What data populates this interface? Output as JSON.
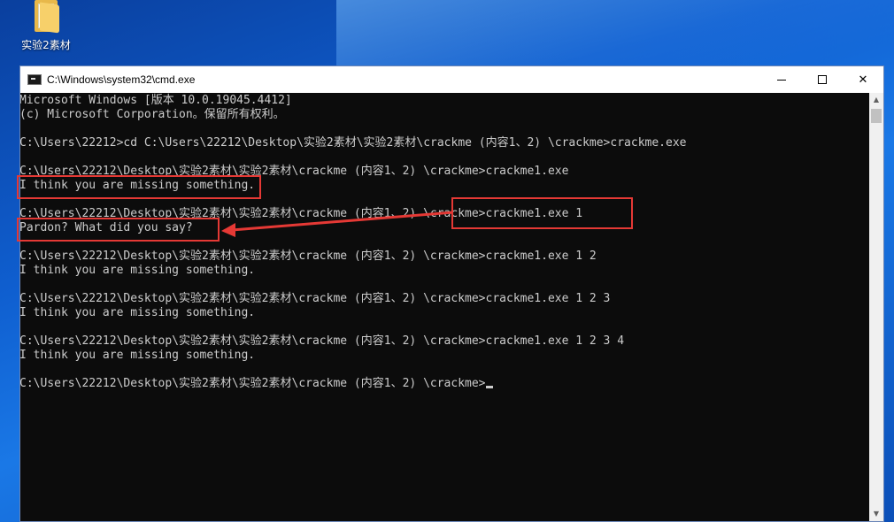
{
  "desktop": {
    "folder_label": "实验2素材"
  },
  "window": {
    "title": "C:\\Windows\\system32\\cmd.exe",
    "btn_minimize": "",
    "btn_maximize": "",
    "btn_close": "✕"
  },
  "console": {
    "lines": [
      "Microsoft Windows [版本 10.0.19045.4412]",
      "(c) Microsoft Corporation。保留所有权利。",
      "",
      "C:\\Users\\22212>cd C:\\Users\\22212\\Desktop\\实验2素材\\实验2素材\\crackme (内容1、2) \\crackme>crackme.exe",
      "",
      "C:\\Users\\22212\\Desktop\\实验2素材\\实验2素材\\crackme (内容1、2) \\crackme>crackme1.exe",
      "I think you are missing something.",
      "",
      "C:\\Users\\22212\\Desktop\\实验2素材\\实验2素材\\crackme (内容1、2) \\crackme>crackme1.exe 1",
      "Pardon? What did you say?",
      "",
      "C:\\Users\\22212\\Desktop\\实验2素材\\实验2素材\\crackme (内容1、2) \\crackme>crackme1.exe 1 2",
      "I think you are missing something.",
      "",
      "C:\\Users\\22212\\Desktop\\实验2素材\\实验2素材\\crackme (内容1、2) \\crackme>crackme1.exe 1 2 3",
      "I think you are missing something.",
      "",
      "C:\\Users\\22212\\Desktop\\实验2素材\\实验2素材\\crackme (内容1、2) \\crackme>crackme1.exe 1 2 3 4",
      "I think you are missing something.",
      "",
      "C:\\Users\\22212\\Desktop\\实验2素材\\实验2素材\\crackme (内容1、2) \\crackme>"
    ]
  },
  "colors": {
    "annotation": "#e53935",
    "console_bg": "#0c0c0c",
    "console_text": "#cccccc"
  },
  "icons": {
    "folder": "folder-icon",
    "cmd": "cmd-icon",
    "minimize": "minimize-icon",
    "maximize": "maximize-icon",
    "close": "close-icon"
  }
}
